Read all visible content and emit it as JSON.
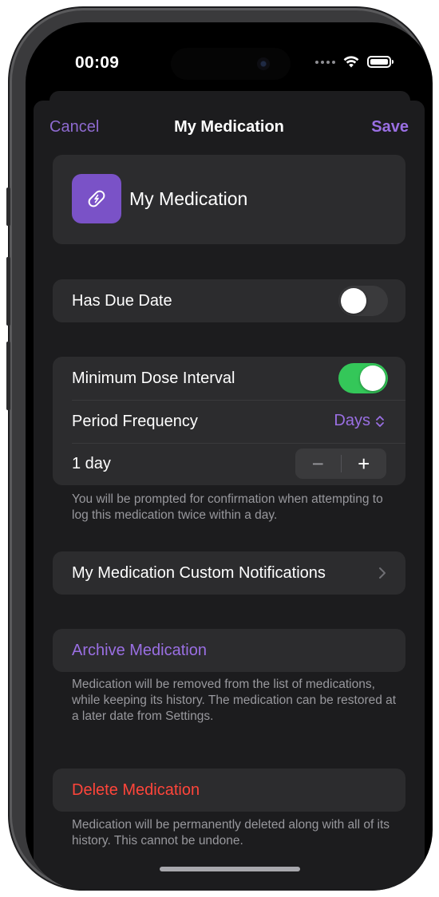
{
  "status_bar": {
    "time": "00:09",
    "icons": [
      "cellular-icon",
      "wifi-icon",
      "battery-icon"
    ]
  },
  "nav": {
    "cancel_label": "Cancel",
    "title": "My Medication",
    "save_label": "Save"
  },
  "medication": {
    "name": "My Medication",
    "icon": "pill-icon",
    "icon_color": "#7a52c7"
  },
  "due_date": {
    "label": "Has Due Date",
    "enabled": false
  },
  "dose_interval": {
    "label": "Minimum Dose Interval",
    "enabled": true,
    "period_label": "Period Frequency",
    "period_value": "Days",
    "amount_label": "1 day",
    "stepper_minus": "−",
    "stepper_plus": "+",
    "footnote": "You will be prompted for confirmation when attempting to log this medication twice within a day."
  },
  "notifications": {
    "label": "My Medication Custom Notifications"
  },
  "archive": {
    "label": "Archive Medication",
    "footnote": "Medication will be removed from the list of medications, while keeping its history. The medication can be restored at a later date from Settings."
  },
  "delete": {
    "label": "Delete Medication",
    "footnote": "Medication will be permanently deleted along with all of its history. This cannot be undone."
  },
  "colors": {
    "accent": "#9a6fe3",
    "toggle_on": "#34c759",
    "destructive": "#ff453a",
    "card": "#2c2c2e",
    "sheet": "#1c1c1e"
  }
}
